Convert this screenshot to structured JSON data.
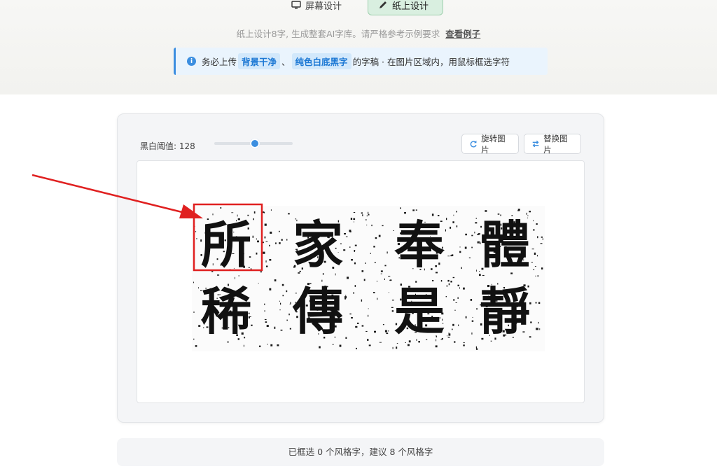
{
  "tabs": {
    "screen_label": "屏幕设计",
    "paper_label": "纸上设计"
  },
  "subtitle": {
    "text": "纸上设计8字, 生成整套AI字库。请严格参考示例要求",
    "link": "查看例子"
  },
  "notice": {
    "prefix": "务必上传",
    "highlight1": "背景干净",
    "sep": "、",
    "highlight2": "纯色白底黑字",
    "suffix": "的字稿 · 在图片区域内，用鼠标框选字符"
  },
  "toolbar": {
    "threshold_label": "黑白阈值: 128",
    "threshold_value": 128,
    "threshold_max": 255,
    "rotate_label": "旋转图片",
    "replace_label": "替换图片"
  },
  "image": {
    "row1": [
      "所",
      "家",
      "奉",
      "體"
    ],
    "row2": [
      "稀",
      "傳",
      "是",
      "靜"
    ]
  },
  "status": {
    "text": "已框选 0 个风格字，建议 8 个风格字"
  },
  "colors": {
    "accent": "#3b8ee0",
    "selection_box": "#e02020",
    "arrow": "#e02020",
    "active_tab_bg": "#d9efe0"
  }
}
